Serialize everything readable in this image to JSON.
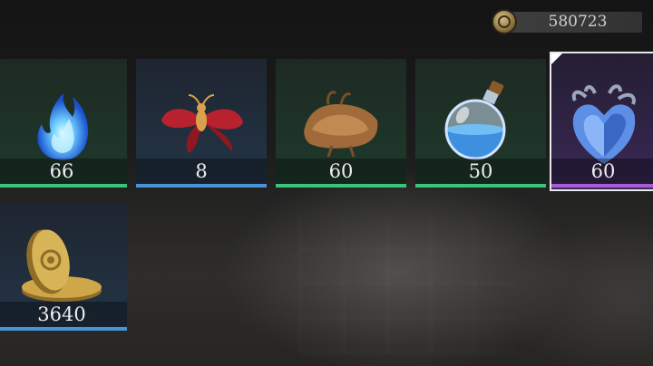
{
  "currency": {
    "icon": "gold-coin-icon",
    "amount": "580723"
  },
  "items": [
    {
      "name": "blue-flame",
      "icon": "blue-flame-icon",
      "quantity": "66",
      "rarity": "green"
    },
    {
      "name": "red-moth",
      "icon": "red-moth-icon",
      "quantity": "8",
      "rarity": "blue"
    },
    {
      "name": "leather-pouch",
      "icon": "leather-pouch-icon",
      "quantity": "60",
      "rarity": "green"
    },
    {
      "name": "blue-potion",
      "icon": "potion-flask-icon",
      "quantity": "50",
      "rarity": "green"
    },
    {
      "name": "crystal-heart",
      "icon": "crystal-heart-icon",
      "quantity": "60",
      "rarity": "purple",
      "selected": true
    },
    {
      "name": "gold-coins",
      "icon": "gold-coins-icon",
      "quantity": "3640",
      "rarity": "blue"
    }
  ],
  "colors": {
    "green": "#3dc27c",
    "blue": "#4a93d6",
    "purple": "#a65ad8"
  }
}
